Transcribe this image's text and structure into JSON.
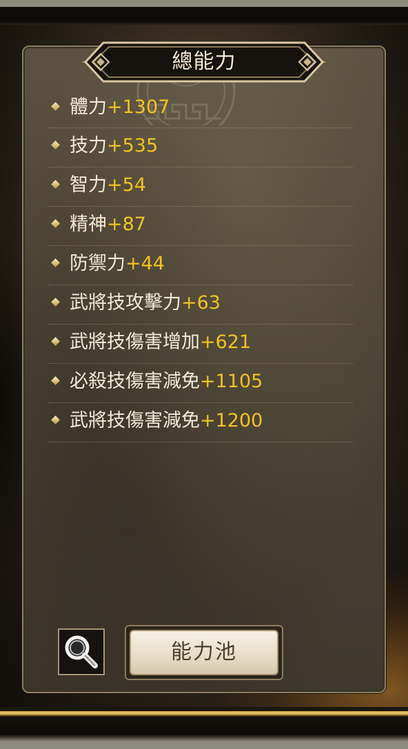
{
  "title": "總能力",
  "stats": [
    {
      "name": "體力",
      "value": "+1307"
    },
    {
      "name": "技力",
      "value": "+535"
    },
    {
      "name": "智力",
      "value": "+54"
    },
    {
      "name": "精神",
      "value": "+87"
    },
    {
      "name": "防禦力",
      "value": "+44"
    },
    {
      "name": "武將技攻擊力",
      "value": "+63"
    },
    {
      "name": "武將技傷害增加",
      "value": "+621"
    },
    {
      "name": "必殺技傷害減免",
      "value": "+1105"
    },
    {
      "name": "武將技傷害減免",
      "value": "+1200"
    }
  ],
  "buttons": {
    "search_icon": "magnifier-icon",
    "pool_label": "能力池"
  },
  "colors": {
    "stat_name": "#f2ead6",
    "stat_value": "#f0c423",
    "title_text": "#f3ead2",
    "panel_border": "#8a7d62"
  }
}
